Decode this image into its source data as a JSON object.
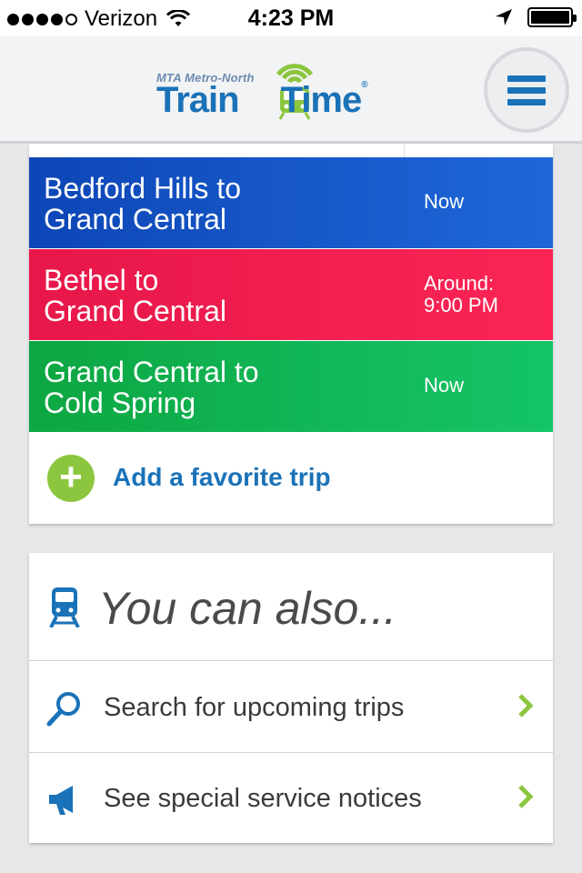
{
  "status_bar": {
    "carrier": "Verizon",
    "time": "4:23 PM",
    "signal_bars_filled": 4,
    "signal_bars_total": 5,
    "battery_level": 1.0
  },
  "header": {
    "logo_sub": "MTA Metro-North",
    "logo_word1": "Train",
    "logo_word2": "Time",
    "logo_trademark": "®"
  },
  "favorites": {
    "trips": [
      {
        "name_line1": "Bedford Hills to",
        "name_line2": "Grand Central",
        "time_line1": "Now",
        "time_line2": "",
        "color": "#1a5cc9"
      },
      {
        "name_line1": "Bethel to",
        "name_line2": "Grand Central",
        "time_line1": "Around:",
        "time_line2": "9:00 PM",
        "color": "#f21e50"
      },
      {
        "name_line1": "Grand Central to",
        "name_line2": "Cold Spring",
        "time_line1": "Now",
        "time_line2": "",
        "color": "#10b554"
      }
    ],
    "add_label": "Add a favorite trip"
  },
  "also": {
    "title": "You can also...",
    "actions": [
      {
        "label": "Search for upcoming trips",
        "icon": "magnifier-icon"
      },
      {
        "label": "See special service notices",
        "icon": "megaphone-icon"
      }
    ]
  },
  "colors": {
    "brand_blue": "#1a72b8",
    "accent_green": "#8cc63f",
    "background": "#e6e7e9"
  }
}
